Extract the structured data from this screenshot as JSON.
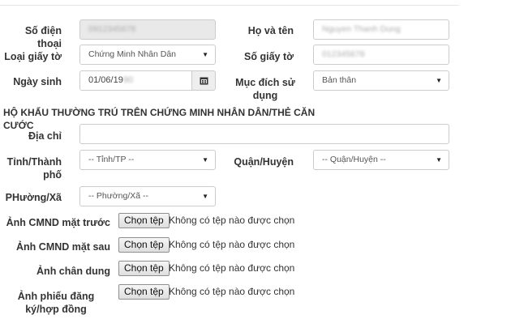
{
  "form": {
    "phone_label": "Số điện thoại",
    "phone_value": "0912345678",
    "fullname_label": "Họ và tên",
    "fullname_value": "Nguyen Thanh Dung",
    "idtype_label": "Loại giấy tờ",
    "idtype_value": "Chứng Minh Nhân Dân",
    "idnumber_label": "Số giấy tờ",
    "idnumber_value": "012345678",
    "dob_label": "Ngày sinh",
    "dob_value": "01/06/19",
    "dob_hidden": "90",
    "purpose_label": "Mục đích sử dụng",
    "purpose_value": "Bản thân",
    "section_title": "HỘ KHẨU THƯỜNG TRÚ TRÊN CHỨNG MINH NHÂN DÂN/THẺ CĂN CƯỚC",
    "address_label": "Địa chỉ",
    "address_value": "",
    "province_label": "Tỉnh/Thành phố",
    "province_value": "-- Tỉnh/TP --",
    "district_label": "Quận/Huyện",
    "district_value": "-- Quận/Huyện --",
    "ward_label": "PHường/Xã",
    "ward_value": "-- Phường/Xã --"
  },
  "uploads": [
    {
      "label": "Ảnh CMND mặt trước",
      "button": "Chọn tệp",
      "status": "Không có tệp nào được chọn"
    },
    {
      "label": "Ảnh CMND mặt sau",
      "button": "Chọn tệp",
      "status": "Không có tệp nào được chọn"
    },
    {
      "label": "Ảnh chân dung",
      "button": "Chọn tệp",
      "status": "Không có tệp nào được chọn"
    },
    {
      "label": "Ảnh phiếu đăng ký/hợp đồng",
      "button": "Chọn tệp",
      "status": "Không có tệp nào được chọn"
    }
  ],
  "icons": {
    "calendar": "calendar-icon",
    "dropdown": "chevron-down-icon"
  }
}
